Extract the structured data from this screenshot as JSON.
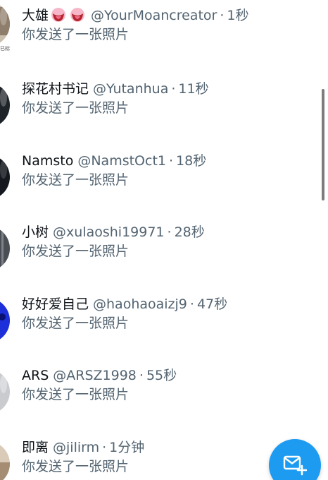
{
  "conversations": [
    {
      "name": "大雄",
      "name_emoji": "tongue-emoji",
      "handle": "@YourMoancreator",
      "separator": "·",
      "time": "1秒",
      "preview": "你发送了一张照片",
      "avatar_badge": "已标秒",
      "avatar_color": "#cbbfae"
    },
    {
      "name": "探花村书记",
      "handle": "@Yutanhua",
      "separator": "·",
      "time": "11秒",
      "preview": "你发送了一张照片",
      "avatar_color": "#1e2329"
    },
    {
      "name": "Namsto",
      "handle": "@NamstOct1",
      "separator": "·",
      "time": "18秒",
      "preview": "你发送了一张照片",
      "avatar_color": "#15191f"
    },
    {
      "name": "小树",
      "handle": "@xulaoshi19971",
      "separator": "·",
      "time": "28秒",
      "preview": "你发送了一张照片",
      "avatar_color": "#4a4f55"
    },
    {
      "name": "好好爱自己",
      "handle": "@haohaoaizj9",
      "separator": "·",
      "time": "47秒",
      "preview": "你发送了一张照片",
      "avatar_color": "#1c2fd8"
    },
    {
      "name": "ARS",
      "handle": "@ARSZ1998",
      "separator": "·",
      "time": "55秒",
      "preview": "你发送了一张照片",
      "avatar_color": "#c9cbcf"
    },
    {
      "name": "即离",
      "handle": "@jilirm",
      "separator": "·",
      "time": "1分钟",
      "preview": "你发送了一张照片",
      "avatar_color": "#d9cbb8"
    }
  ],
  "fab": {
    "icon": "new-message-icon",
    "color": "#1d9bf0"
  }
}
